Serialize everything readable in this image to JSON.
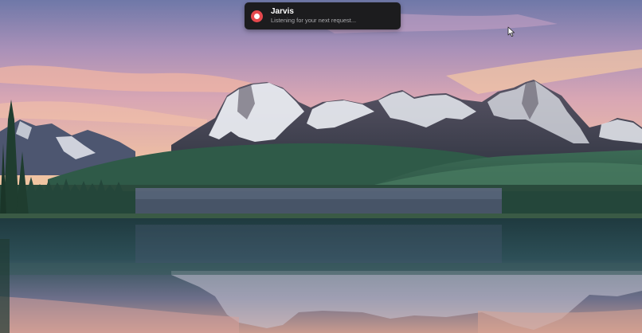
{
  "notification": {
    "app_name": "Jarvis",
    "status_text": "Listening for your next request...",
    "icon": "record-icon",
    "icon_color": "#e5484d",
    "background_color": "#1c1c1e"
  },
  "desktop": {
    "wallpaper": "mountain-lake-sunset",
    "cursor_icon": "arrow-pointer-icon"
  }
}
